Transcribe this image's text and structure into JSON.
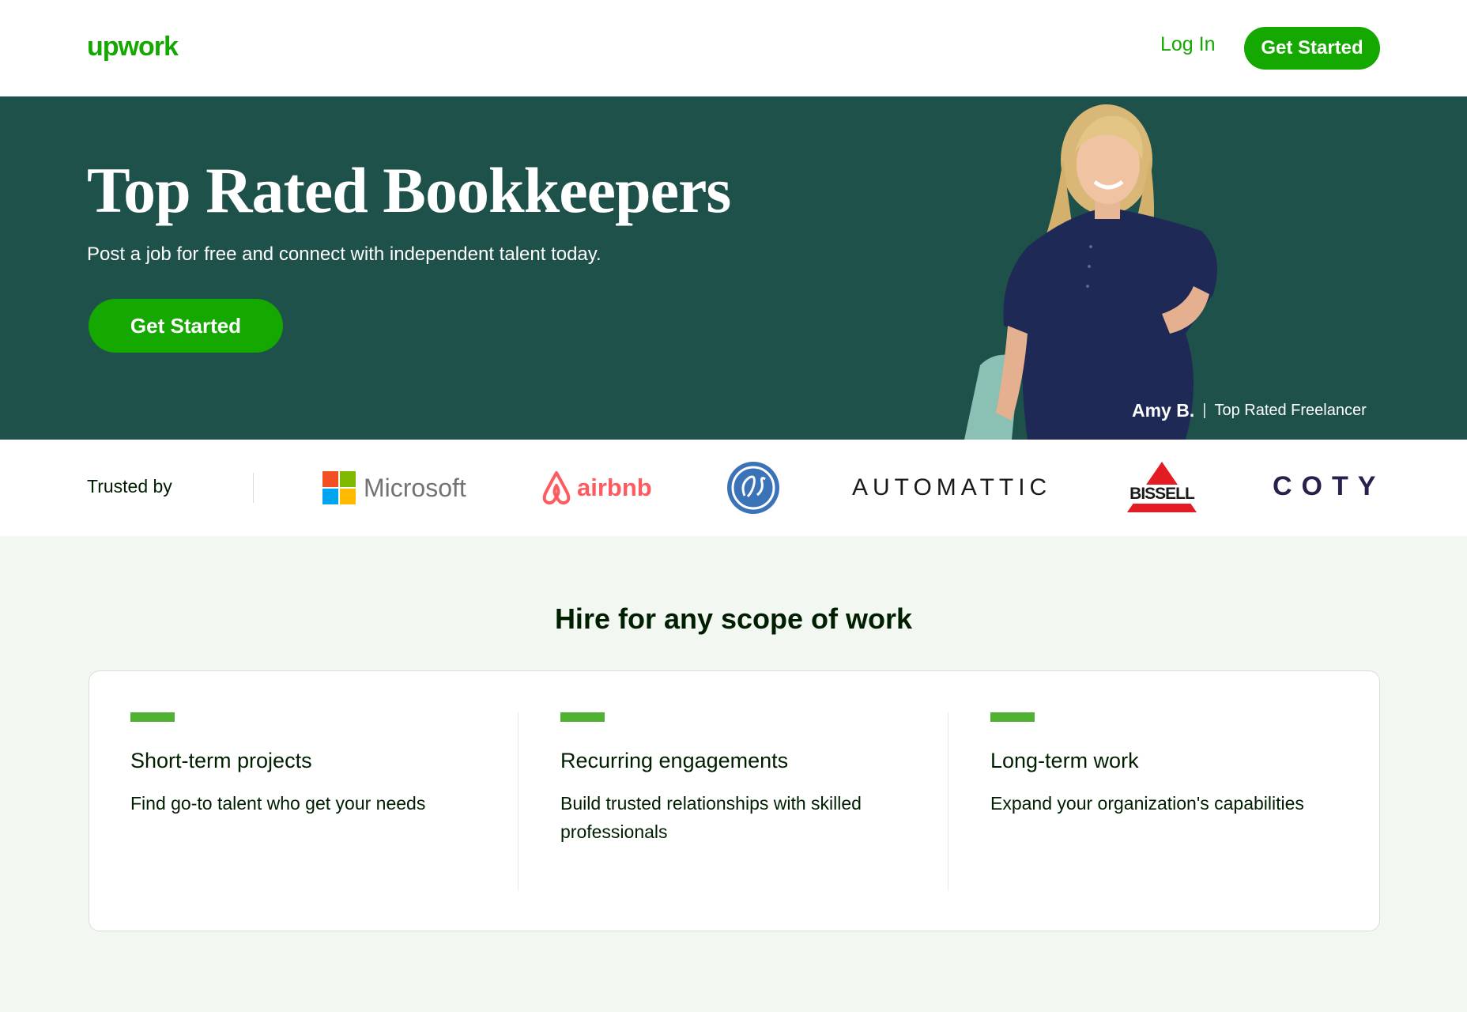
{
  "header": {
    "logo_text": "upwork",
    "login_label": "Log In",
    "cta_label": "Get Started"
  },
  "hero": {
    "title": "Top Rated Bookkeepers",
    "subtitle": "Post a job for free and connect with independent talent today.",
    "cta_label": "Get Started",
    "freelancer_name": "Amy B.",
    "separator": "|",
    "freelancer_badge": "Top Rated Freelancer"
  },
  "trusted": {
    "label": "Trusted by",
    "brands": [
      "Microsoft",
      "airbnb",
      "GE",
      "AUTOMATTIC",
      "BISSELL",
      "COTY"
    ]
  },
  "scope": {
    "title": "Hire for any scope of work",
    "columns": [
      {
        "title": "Short-term projects",
        "desc": "Find go-to talent who get your needs"
      },
      {
        "title": "Recurring engagements",
        "desc": "Build trusted relationships with skilled professionals"
      },
      {
        "title": "Long-term work",
        "desc": "Expand your organization's capabilities"
      }
    ]
  },
  "colors": {
    "brand_green": "#14a800",
    "hero_bg": "#1f514b",
    "section_bg": "#f2f7f2",
    "accent_bar": "#4fb232"
  }
}
